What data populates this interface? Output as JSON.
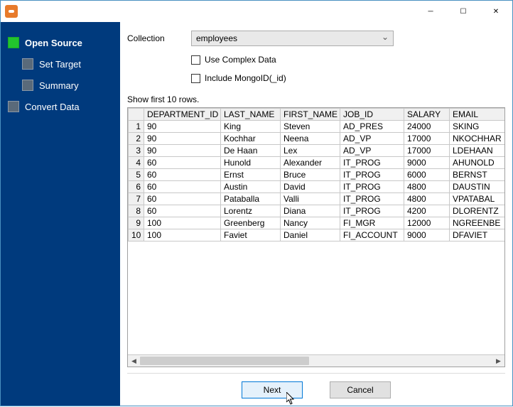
{
  "sidebar": {
    "steps": [
      {
        "label": "Open Source",
        "active": true,
        "sub": false
      },
      {
        "label": "Set Target",
        "active": false,
        "sub": true
      },
      {
        "label": "Summary",
        "active": false,
        "sub": true
      },
      {
        "label": "Convert Data",
        "active": false,
        "sub": false
      }
    ]
  },
  "form": {
    "collection_label": "Collection",
    "collection_value": "employees",
    "checkbox_complex": "Use Complex Data",
    "checkbox_mongoid": "Include MongoID(_id)"
  },
  "preview": {
    "label": "Show first 10 rows.",
    "columns": [
      "DEPARTMENT_ID",
      "LAST_NAME",
      "FIRST_NAME",
      "JOB_ID",
      "SALARY",
      "EMAIL"
    ],
    "rows": [
      [
        "90",
        "King",
        "Steven",
        "AD_PRES",
        "24000",
        "SKING"
      ],
      [
        "90",
        "Kochhar",
        "Neena",
        "AD_VP",
        "17000",
        "NKOCHHAR"
      ],
      [
        "90",
        "De Haan",
        "Lex",
        "AD_VP",
        "17000",
        "LDEHAAN"
      ],
      [
        "60",
        "Hunold",
        "Alexander",
        "IT_PROG",
        "9000",
        "AHUNOLD"
      ],
      [
        "60",
        "Ernst",
        "Bruce",
        "IT_PROG",
        "6000",
        "BERNST"
      ],
      [
        "60",
        "Austin",
        "David",
        "IT_PROG",
        "4800",
        "DAUSTIN"
      ],
      [
        "60",
        "Pataballa",
        "Valli",
        "IT_PROG",
        "4800",
        "VPATABAL"
      ],
      [
        "60",
        "Lorentz",
        "Diana",
        "IT_PROG",
        "4200",
        "DLORENTZ"
      ],
      [
        "100",
        "Greenberg",
        "Nancy",
        "FI_MGR",
        "12000",
        "NGREENBE"
      ],
      [
        "100",
        "Faviet",
        "Daniel",
        "FI_ACCOUNT",
        "9000",
        "DFAVIET"
      ]
    ]
  },
  "buttons": {
    "next": "Next",
    "cancel": "Cancel"
  }
}
